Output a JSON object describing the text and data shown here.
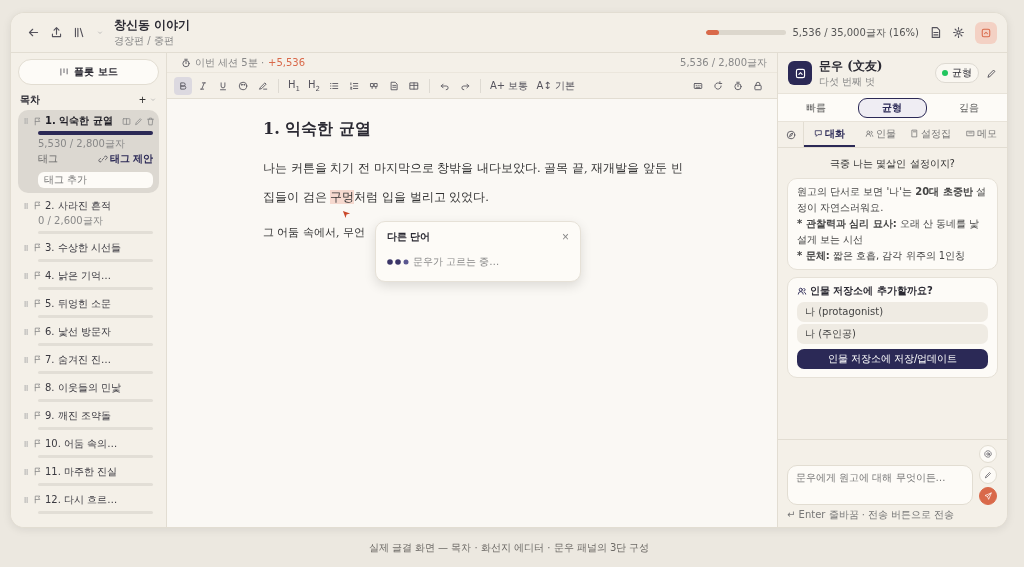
{
  "topbar": {
    "title": "창신동 이야기",
    "subtitle": "경장편 / 중편",
    "progress": {
      "level": 0.16,
      "reading": "5,536 / 35,000글자 (16%)"
    },
    "ai_toggle_on": true
  },
  "sidebar": {
    "plot_button": "플롯 보드",
    "toc_label": "목차",
    "add": "+",
    "chapters": [
      {
        "title": "1. 익숙한 균열",
        "selected": true,
        "count": "5,530 / 2,800글자",
        "level": 1,
        "tags_label": "태그",
        "tag_suggest": "태그 제안",
        "tag_placeholder": "태그 추가"
      },
      {
        "title": "2. 사라진 흔적",
        "selected": false,
        "count": "0 / 2,600글자",
        "level": 0
      },
      {
        "title": "3. 수상한 시선들",
        "selected": false,
        "level": 0
      },
      {
        "title": "4. 낡은 기억…",
        "selected": false,
        "level": 0
      },
      {
        "title": "5. 뒤엉힌 소문",
        "selected": false,
        "level": 0
      },
      {
        "title": "6. 낯선 방문자",
        "selected": false,
        "level": 0
      },
      {
        "title": "7. 숨겨진 진…",
        "selected": false,
        "level": 0
      },
      {
        "title": "8. 이웃들의 민낯",
        "selected": false,
        "level": 0
      },
      {
        "title": "9. 깨진 조약돌",
        "selected": false,
        "level": 0
      },
      {
        "title": "10. 어둠 속의…",
        "selected": false,
        "level": 0
      },
      {
        "title": "11. 마주한 진실",
        "selected": false,
        "level": 0
      },
      {
        "title": "12. 다시 흐르…",
        "selected": false,
        "level": 0
      }
    ]
  },
  "editor": {
    "session": "이번 세션 5분 ·",
    "session_delta": "+5,536",
    "count": "5,536 / 2,800글자",
    "toolbar": [
      {
        "kind": "icon",
        "selected": true
      },
      {
        "kind": "icon",
        "selected": false
      },
      {
        "kind": "icon",
        "selected": false
      },
      {
        "kind": "icon",
        "selected": false
      },
      {
        "kind": "icon",
        "selected": false
      },
      {
        "kind": "sep"
      },
      {
        "kind": "text",
        "label": "H$_{1}$"
      },
      {
        "kind": "text",
        "label": "H$_{2}$"
      },
      {
        "kind": "icon",
        "selected": false
      },
      {
        "kind": "icon",
        "selected": false
      },
      {
        "kind": "icon",
        "selected": false
      },
      {
        "kind": "icon",
        "selected": false
      },
      {
        "kind": "icon",
        "selected": false
      },
      {
        "kind": "sep"
      },
      {
        "kind": "icon",
        "selected": false
      },
      {
        "kind": "icon",
        "selected": false
      },
      {
        "kind": "sep"
      },
      {
        "kind": "text",
        "label": "A+ 보통"
      },
      {
        "kind": "text",
        "label": "A↕ 기본"
      }
    ],
    "heading": "1. 익숙한 균열",
    "paragraphs": [
      {
        "before": "나는 커튼을 치기 전 마지막으로 창밖을 내다보았다. 골목 끝, 재개발을 앞둔 빈집들이 검은 ",
        "highlight": "구멍",
        "after": "처럼 입을 벌리고 있었다."
      },
      {
        "before": "그 어둠 속에서, 무언"
      }
    ],
    "popup": {
      "title": "다른 단어",
      "close": "×",
      "status": "문우가 고르는 중…"
    }
  },
  "panel": {
    "name": "문우 (文友)",
    "subtitle": "다섯 번째 벗",
    "status": {
      "label": "균형",
      "color": "#22c55e"
    },
    "modes": [
      {
        "label": "빠름",
        "selected": false
      },
      {
        "label": "균형",
        "selected": true
      },
      {
        "label": "깊음",
        "selected": false
      }
    ],
    "tabs": [
      {
        "label": "대화",
        "selected": true
      },
      {
        "label": "인물",
        "selected": false
      },
      {
        "label": "설정집",
        "selected": false
      },
      {
        "label": "메모",
        "selected": false
      }
    ],
    "question": "극중 나는 몇살인 설정이지?",
    "answer": [
      {
        "text": "원고의 단서로 보면 '나'는 **20대 초중반** 설정이 자연스러워요."
      },
      {
        "marker": "*",
        "text": "**관찰력과 심리 묘사:** 오래 산 동네를 낯설게 보는 시선"
      },
      {
        "marker": "*",
        "text": "**문체:** 짧은 호흡, 감각 위주의 1인칭"
      }
    ],
    "card": {
      "title": "인물 저장소에 추가할까요?",
      "options": [
        "나 (protagonist)",
        "나 (주인공)"
      ],
      "button": "인물 저장소에 저장/업데이트"
    },
    "input_placeholder": "문우에게 원고에 대해 무엇이든…",
    "hint": "↵ Enter 줄바꿈 · 전송 버튼으로 전송"
  },
  "caption": "실제 글결 화면 — 목차 · 화선지 에디터 · 문우 패널의 3단 구성"
}
